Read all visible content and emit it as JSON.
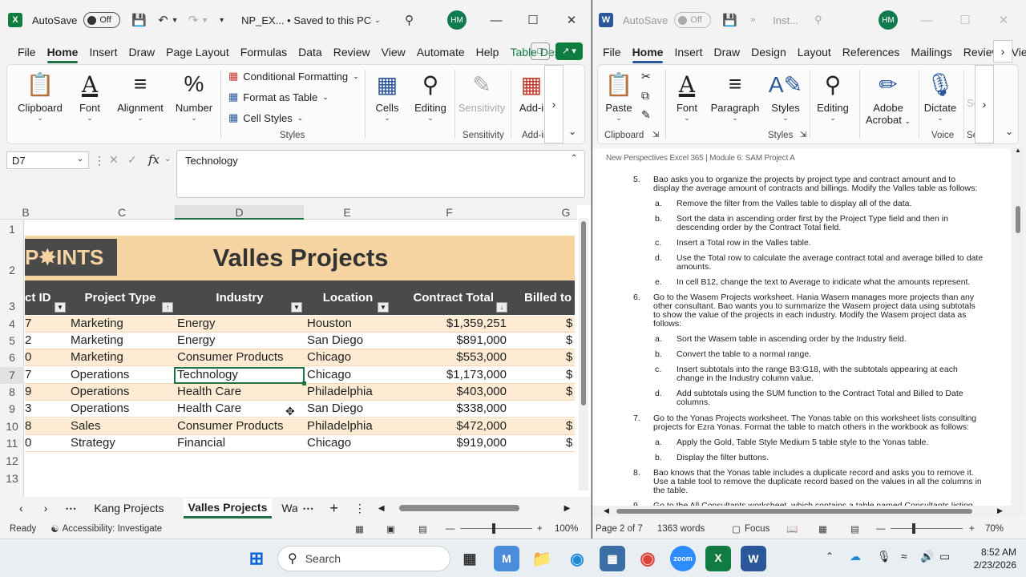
{
  "excel": {
    "autosave_label": "AutoSave",
    "autosave_state": "Off",
    "filename": "NP_EX... • Saved to this PC",
    "avatar_initials": "HM",
    "tabs": [
      "File",
      "Home",
      "Insert",
      "Draw",
      "Page Layout",
      "Formulas",
      "Data",
      "Review",
      "View",
      "Automate",
      "Help",
      "Table Design"
    ],
    "ribbon": {
      "clipboard": "Clipboard",
      "font": "Font",
      "alignment": "Alignment",
      "number": "Number",
      "conditional_formatting": "Conditional Formatting",
      "format_as_table": "Format as Table",
      "cell_styles": "Cell Styles",
      "styles_group": "Styles",
      "cells": "Cells",
      "editing": "Editing",
      "sensitivity": "Sensitivity",
      "sensitivity_group": "Sensitivity",
      "addins": "Add-i",
      "addins_group": "Add-in"
    },
    "name_box": "D7",
    "formula": "Technology",
    "columns": [
      "B",
      "C",
      "D",
      "E",
      "F",
      "G"
    ],
    "rows": [
      "1",
      "2",
      "3",
      "4",
      "5",
      "6",
      "7",
      "8",
      "9",
      "10",
      "11",
      "12",
      "13"
    ],
    "banner_logo": "P✸INTS",
    "sheet_title": "Valles Projects",
    "headers": [
      "ct ID",
      "Project Type",
      "Industry",
      "Location",
      "Contract Total",
      "Billed to"
    ],
    "data": [
      {
        "id": "7",
        "type": "Marketing",
        "industry": "Energy",
        "location": "Houston",
        "total": "$1,359,251",
        "billed": "$"
      },
      {
        "id": "2",
        "type": "Marketing",
        "industry": "Energy",
        "location": "San Diego",
        "total": "$891,000",
        "billed": "$"
      },
      {
        "id": "0",
        "type": "Marketing",
        "industry": "Consumer Products",
        "location": "Chicago",
        "total": "$553,000",
        "billed": "$"
      },
      {
        "id": "7",
        "type": "Operations",
        "industry": "Technology",
        "location": "Chicago",
        "total": "$1,173,000",
        "billed": "$"
      },
      {
        "id": "9",
        "type": "Operations",
        "industry": "Health Care",
        "location": "Philadelphia",
        "total": "$403,000",
        "billed": "$"
      },
      {
        "id": "3",
        "type": "Operations",
        "industry": "Health Care",
        "location": "San Diego",
        "total": "$338,000",
        "billed": ""
      },
      {
        "id": "8",
        "type": "Sales",
        "industry": "Consumer Products",
        "location": "Philadelphia",
        "total": "$472,000",
        "billed": "$"
      },
      {
        "id": "0",
        "type": "Strategy",
        "industry": "Financial",
        "location": "Chicago",
        "total": "$919,000",
        "billed": "$"
      }
    ],
    "sheet_tabs": [
      "Kang Projects",
      "Valles Projects",
      "Wa"
    ],
    "status_ready": "Ready",
    "status_accessibility": "Accessibility: Investigate",
    "zoom": "100%"
  },
  "word": {
    "autosave_label": "AutoSave",
    "autosave_state": "Off",
    "filename": "Inst...",
    "avatar_initials": "HM",
    "tabs": [
      "File",
      "Home",
      "Insert",
      "Draw",
      "Design",
      "Layout",
      "References",
      "Mailings",
      "Review",
      "View"
    ],
    "ribbon": {
      "paste": "Paste",
      "clipboard": "Clipboard",
      "font": "Font",
      "paragraph": "Paragraph",
      "styles": "Styles",
      "styles_group": "Styles",
      "editing": "Editing",
      "adobe": "Adobe",
      "acrobat": "Acrobat",
      "dictate": "Dictate",
      "voice": "Voice",
      "se": "Se"
    },
    "doc_header": "New Perspectives Excel 365 | Module 6: SAM Project A",
    "lines": [
      {
        "n": "5.",
        "t": "Bao asks you to organize the projects by project type and contract amount and to"
      },
      {
        "t": "display the average amount of contracts and billings. Modify the Valles table as follows:"
      },
      {
        "n": "a.",
        "t": "Remove the filter from the Valles table to display all of the data."
      },
      {
        "n": "b.",
        "t": "Sort the data in ascending order first by the Project Type field and then in"
      },
      {
        "t": "descending order by the Contract Total field."
      },
      {
        "n": "c.",
        "t": "Insert a Total row in the Valles table."
      },
      {
        "n": "d.",
        "t": "Use the Total row to calculate the average contract total and average billed to date"
      },
      {
        "t": "amounts."
      },
      {
        "n": "e.",
        "t": "In cell B12, change the text to Average to indicate what the amounts represent."
      },
      {
        "n": "6.",
        "t": "Go to the Wasem Projects worksheet. Hania Wasem manages more projects than any"
      },
      {
        "t": "other consultant. Bao wants you to summarize the Wasem project data using subtotals"
      },
      {
        "t": "to show the value of the projects in each industry. Modify the Wasem project data as"
      },
      {
        "t": "follows:"
      },
      {
        "n": "a.",
        "t": "Sort the Wasem table in ascending order by the Industry field."
      },
      {
        "n": "b.",
        "t": "Convert the table to a normal range."
      },
      {
        "n": "c.",
        "t": "Insert subtotals into the range B3:G18, with the subtotals appearing at each"
      },
      {
        "t": "change in the Industry column value."
      },
      {
        "n": "d.",
        "t": "Add subtotals using the SUM function to the Contract Total and Billed to Date"
      },
      {
        "t": "columns."
      },
      {
        "n": "7.",
        "t": "Go to the Yonas Projects worksheet. The Yonas table on this worksheet lists consulting"
      },
      {
        "t": "projects for Ezra Yonas. Format the table to match others in the workbook as follows:"
      },
      {
        "n": "a.",
        "t": "Apply the Gold, Table Style Medium 5 table style to the Yonas table."
      },
      {
        "n": "b.",
        "t": "Display the filter buttons."
      },
      {
        "n": "8.",
        "t": "Bao knows that the Yonas table includes a duplicate record and asks you to remove it."
      },
      {
        "t": "Use a table tool to remove the duplicate record based on the values in all the columns in"
      },
      {
        "t": "the table."
      },
      {
        "n": "9.",
        "t": "Go to the All Consultants worksheet, which contains a table named Consultants listing"
      }
    ],
    "status_page": "Page 2 of 7",
    "status_words": "1363 words",
    "status_focus": "Focus",
    "zoom": "70%"
  },
  "taskbar": {
    "search_placeholder": "Search",
    "time": "8:52 AM",
    "date": "2/23/2026"
  }
}
